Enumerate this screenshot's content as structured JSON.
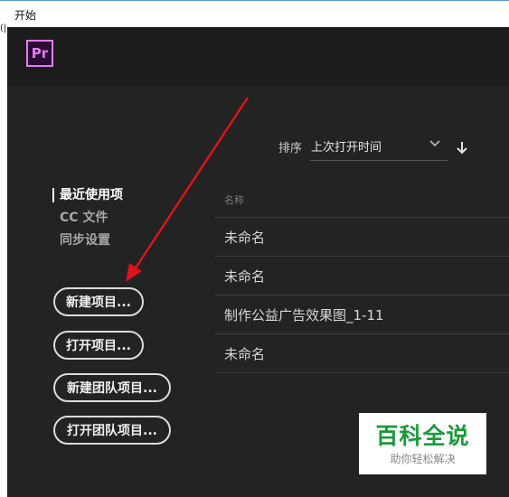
{
  "window": {
    "title": "开始",
    "edge_glyph": "(|"
  },
  "app": {
    "logo_text": "Pr"
  },
  "sort": {
    "label": "排序",
    "value": "上次打开时间",
    "chevron_icon": "chevron-down-icon",
    "direction_icon": "arrow-down-icon"
  },
  "sidebar": {
    "items": [
      {
        "label": "最近使用项",
        "active": true
      },
      {
        "label": "CC 文件",
        "active": false
      },
      {
        "label": "同步设置",
        "active": false
      }
    ]
  },
  "actions": {
    "new_project": "新建项目...",
    "open_project": "打开项目...",
    "new_team_project": "新建团队项目...",
    "open_team_project": "打开团队项目..."
  },
  "recent": {
    "column_header": "名称",
    "items": [
      "未命名",
      "未命名",
      "制作公益广告效果图_1-11",
      "未命名"
    ]
  },
  "watermark": {
    "title": "百科全说",
    "subtitle": "助你轻松解决"
  },
  "colors": {
    "accent_logo": "#e77cf6",
    "annotation_arrow": "#d9161c",
    "watermark_green": "#1a9a3a",
    "app_bg": "#232323"
  }
}
